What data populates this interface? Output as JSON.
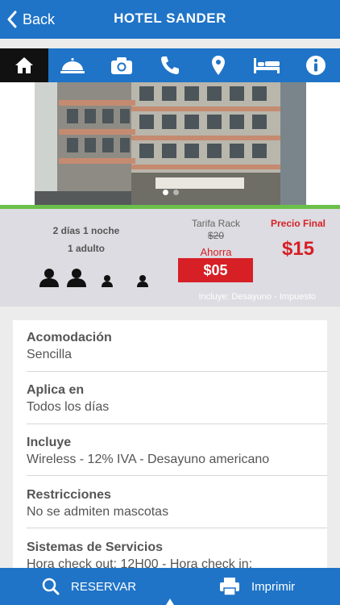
{
  "header": {
    "back_label": "Back",
    "title": "HOTEL SANDER"
  },
  "tabs": [
    {
      "icon": "home-icon",
      "active": true
    },
    {
      "icon": "room-service-icon"
    },
    {
      "icon": "camera-icon"
    },
    {
      "icon": "phone-icon"
    },
    {
      "icon": "map-pin-icon"
    },
    {
      "icon": "bed-icon"
    },
    {
      "icon": "info-icon"
    }
  ],
  "carousel": {
    "active_index": 0,
    "count": 2
  },
  "offer": {
    "stay": "2 días 1 noche",
    "guests": "1 adulto",
    "rack_label": "Tarifa Rack",
    "rack_value": "$20",
    "savings_label": "Ahorra",
    "savings_value": "$05",
    "final_label": "Precio Final",
    "final_value": "$15",
    "includes": "Incluye: Desayuno - Impuesto"
  },
  "details": [
    {
      "label": "Acomodación",
      "value": "Sencilla"
    },
    {
      "label": "Aplica en",
      "value": "Todos los días"
    },
    {
      "label": "Incluye",
      "value": "Wireless - 12% IVA - Desayuno americano"
    },
    {
      "label": "Restricciones",
      "value": "No se admiten mascotas"
    },
    {
      "label": "Sistemas de Servicios",
      "value": "Hora check out: 12H00 - Hora check in:"
    }
  ],
  "bottom_bar": {
    "reserve_label": "RESERVAR",
    "print_label": "Imprimir"
  },
  "colors": {
    "primary": "#1f74c7",
    "accent_red": "#d71f26",
    "accent_green": "#6cc04a"
  }
}
